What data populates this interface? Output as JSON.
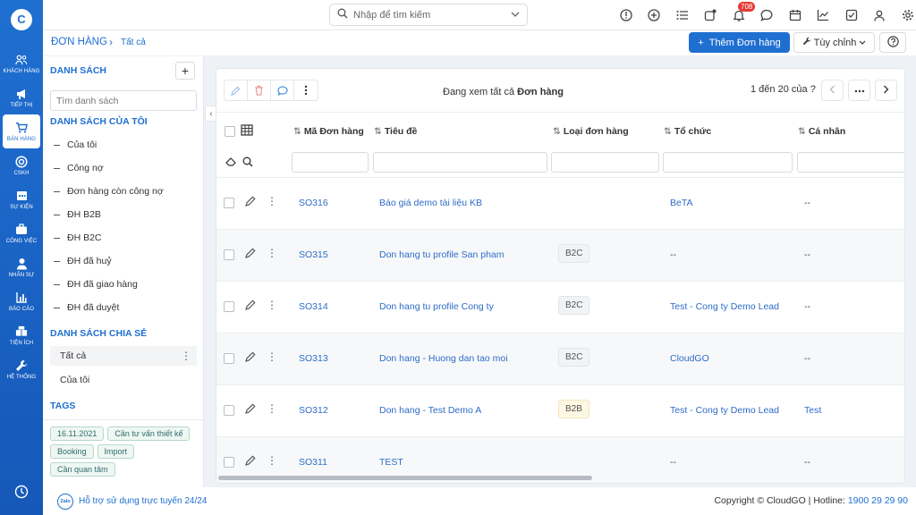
{
  "rail": {
    "logo": "C",
    "items": [
      {
        "label": "KHÁCH HÀNG",
        "icon": "users-icon"
      },
      {
        "label": "TIẾP THỊ",
        "icon": "megaphone-icon"
      },
      {
        "label": "BÁN HÀNG",
        "icon": "cart-icon",
        "active": true
      },
      {
        "label": "CSKH",
        "icon": "lifebuoy-icon"
      },
      {
        "label": "SỰ KIỆN",
        "icon": "calendar-icon"
      },
      {
        "label": "CÔNG VIỆC",
        "icon": "briefcase-icon"
      },
      {
        "label": "NHÂN SỰ",
        "icon": "person-icon"
      },
      {
        "label": "BÁO CÁO",
        "icon": "report-icon"
      },
      {
        "label": "TIỆN ÍCH",
        "icon": "boxes-icon"
      },
      {
        "label": "HỆ THỐNG",
        "icon": "wrench-icon"
      }
    ]
  },
  "topbar": {
    "search_placeholder": "Nhập để tìm kiếm",
    "notification_count": "708",
    "icons": [
      "info-icon",
      "add-circle-icon",
      "list-icon",
      "refresh-icon",
      "bell-icon",
      "chat-icon",
      "calendar-icon",
      "chart-icon",
      "task-check-icon",
      "user-icon",
      "gear-icon"
    ]
  },
  "breadcrumb": {
    "module": "ĐƠN HÀNG",
    "view": "Tất cả"
  },
  "actions": {
    "add_label": "Thêm Đơn hàng",
    "customize_label": "Tùy chỉnh"
  },
  "sidebar": {
    "list_heading": "DANH SÁCH",
    "search_placeholder": "Tìm danh sách",
    "my_lists_heading": "DANH SÁCH CỦA TÔI",
    "my_lists": [
      "Của tôi",
      "Công nợ",
      "Đơn hàng còn công nợ",
      "ĐH B2B",
      "ĐH B2C",
      "ĐH đã huỷ",
      "ĐH đã giao hàng",
      "ĐH đã duyệt"
    ],
    "shared_heading": "DANH SÁCH CHIA SẺ",
    "shared_lists": [
      "Tất cả",
      "Của tôi"
    ],
    "tags_heading": "TAGS",
    "tags": [
      "16.11.2021",
      "Cần tư vấn thiết kế",
      "Booking",
      "Import",
      "Cần quan tâm"
    ]
  },
  "main": {
    "viewing_prefix": "Đang xem tất cả",
    "viewing_module": "Đơn hàng",
    "pager_text": "1 đến 20 của",
    "pager_unknown": "?",
    "columns": [
      "Mã Đơn hàng",
      "Tiêu đề",
      "Loại đơn hàng",
      "Tổ chức",
      "Cá nhân"
    ],
    "rows": [
      {
        "code": "SO316",
        "title": "Báo giá demo tài liệu KB",
        "type": "",
        "org": "BeTA",
        "person": "--"
      },
      {
        "code": "SO315",
        "title": "Don hang tu profile San pham",
        "type": "B2C",
        "org": "--",
        "person": "--"
      },
      {
        "code": "SO314",
        "title": "Don hang tu profile Cong ty",
        "type": "B2C",
        "org": "Test - Cong ty Demo Lead",
        "person": "--"
      },
      {
        "code": "SO313",
        "title": "Don hang - Huong dan tao moi",
        "type": "B2C",
        "org": "CloudGO",
        "person": "--"
      },
      {
        "code": "SO312",
        "title": "Don hang - Test Demo A",
        "type": "B2B",
        "org": "Test - Cong ty Demo Lead",
        "person": "Test"
      },
      {
        "code": "SO311",
        "title": "TEST",
        "type": "",
        "org": "--",
        "person": "--"
      }
    ]
  },
  "footer": {
    "support": "Hỗ trợ sử dụng trực tuyến 24/24",
    "zalo": "Zalo",
    "copyright": "Copyright © CloudGO",
    "hotline_label": "Hotline:",
    "hotline": "1900 29 29 90"
  },
  "colors": {
    "primary": "#1f6fd1",
    "link": "#2e6cc7",
    "badge": "#e53935"
  }
}
